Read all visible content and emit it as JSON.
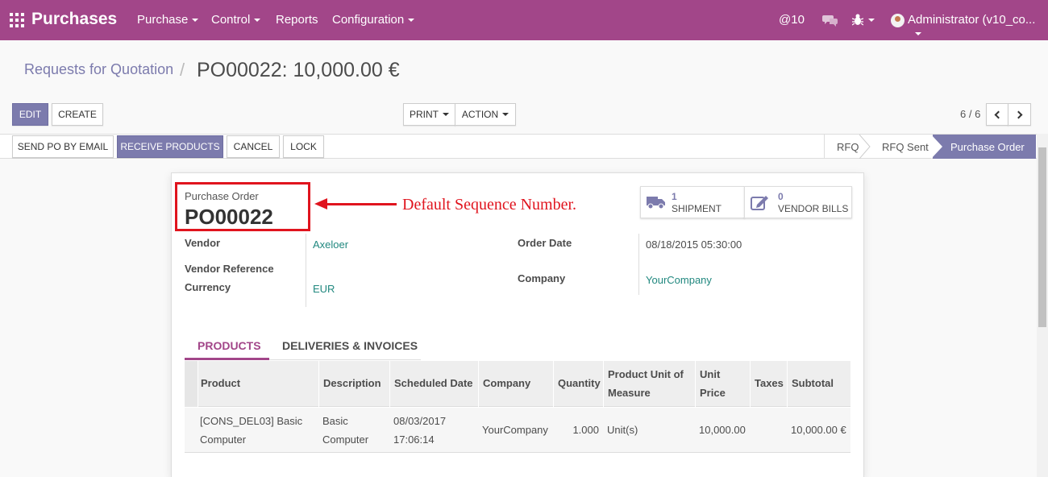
{
  "app": {
    "title": "Purchases",
    "menus": [
      "Purchase",
      "Control",
      "Reports",
      "Configuration"
    ],
    "mentions_count": "@10",
    "user": "Administrator (v10_co..."
  },
  "breadcrumb": {
    "parent": "Requests for Quotation",
    "separator": "/",
    "current": "PO00022: 10,000.00 €"
  },
  "toolbar": {
    "edit": "EDIT",
    "create": "CREATE",
    "print": "PRINT",
    "action": "ACTION",
    "pager": "6 / 6"
  },
  "statusbar": {
    "buttons": [
      "SEND PO BY EMAIL",
      "RECEIVE PRODUCTS",
      "CANCEL",
      "LOCK"
    ],
    "stages": [
      "RFQ",
      "RFQ Sent",
      "Purchase Order"
    ],
    "active_stage": "Purchase Order"
  },
  "form": {
    "kicker": "Purchase Order",
    "name": "PO00022",
    "annotation": "Default Sequence Number.",
    "smart_buttons": [
      {
        "count": "1",
        "label": "SHIPMENT",
        "icon": "truck-icon"
      },
      {
        "count": "0",
        "label": "VENDOR BILLS",
        "icon": "pencil-square-icon"
      }
    ],
    "fields": {
      "vendor_label": "Vendor",
      "vendor_value": "Axeloer",
      "vendor_ref_label": "Vendor Reference",
      "currency_label": "Currency",
      "currency_value": "EUR",
      "order_date_label": "Order Date",
      "order_date_value": "08/18/2015 05:30:00",
      "company_label": "Company",
      "company_value": "YourCompany"
    }
  },
  "tabs": [
    "PRODUCTS",
    "DELIVERIES & INVOICES"
  ],
  "table": {
    "headers": [
      "Product",
      "Description",
      "Scheduled Date",
      "Company",
      "Quantity",
      "Product Unit of Measure",
      "Unit Price",
      "Taxes",
      "Subtotal"
    ],
    "rows": [
      {
        "product": "[CONS_DEL03] Basic Computer",
        "description": "Basic Computer",
        "scheduled_date": "08/03/2017 17:06:14",
        "company": "YourCompany",
        "quantity": "1.000",
        "uom": "Unit(s)",
        "unit_price": "10,000.00",
        "taxes": "",
        "subtotal": "10,000.00 €"
      }
    ]
  },
  "colors": {
    "navbar": "#a24689",
    "primary": "#7c7bad",
    "link": "#21887f",
    "annotation": "#e0141e"
  }
}
